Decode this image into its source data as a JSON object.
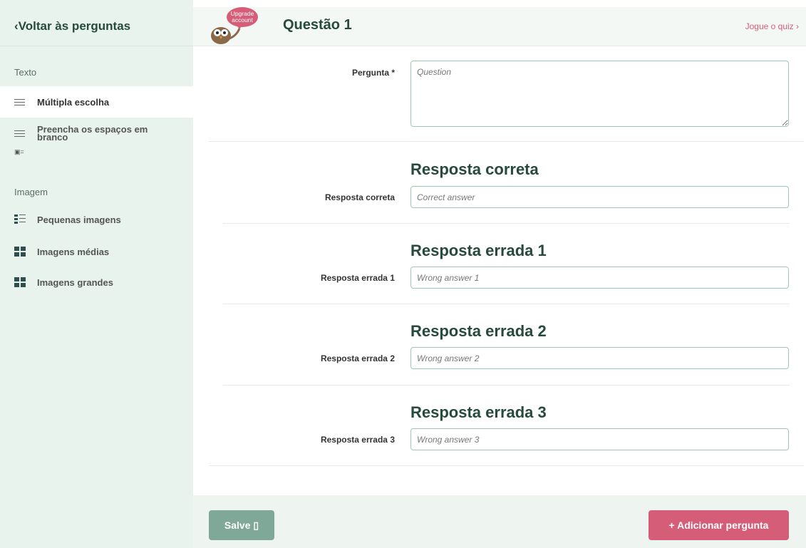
{
  "sidebar": {
    "back_label": "‹Voltar às perguntas",
    "text_section": "Texto",
    "image_section": "Imagem",
    "items": [
      {
        "label": "Múltipla escolha"
      },
      {
        "label": "Preencha os espaços em branco"
      },
      {
        "label": "Pequenas imagens"
      },
      {
        "label": "Imagens médias"
      },
      {
        "label": "Imagens grandes"
      }
    ],
    "fill_blank_sub_icon": "▣="
  },
  "header": {
    "upgrade_label": "Upgrade account",
    "title": "Questão 1",
    "play_link": "Jogue o quiz ›"
  },
  "form": {
    "question_label": "Pergunta *",
    "question_placeholder": "Question",
    "correct": {
      "heading": "Resposta correta",
      "label": "Resposta correta",
      "placeholder": "Correct answer"
    },
    "wrong": [
      {
        "heading": "Resposta errada 1",
        "label": "Resposta errada 1",
        "placeholder": "Wrong answer 1"
      },
      {
        "heading": "Resposta errada 2",
        "label": "Resposta errada 2",
        "placeholder": "Wrong answer 2"
      },
      {
        "heading": "Resposta errada 3",
        "label": "Resposta errada 3",
        "placeholder": "Wrong answer 3"
      }
    ]
  },
  "footer": {
    "save_label": "Salve ▯",
    "add_label": "+ Adicionar pergunta"
  },
  "colors": {
    "accent_green": "#264a3c",
    "accent_pink": "#d65d78",
    "sidebar_bg": "#e7f3ec",
    "save_bg": "#7fa899"
  }
}
